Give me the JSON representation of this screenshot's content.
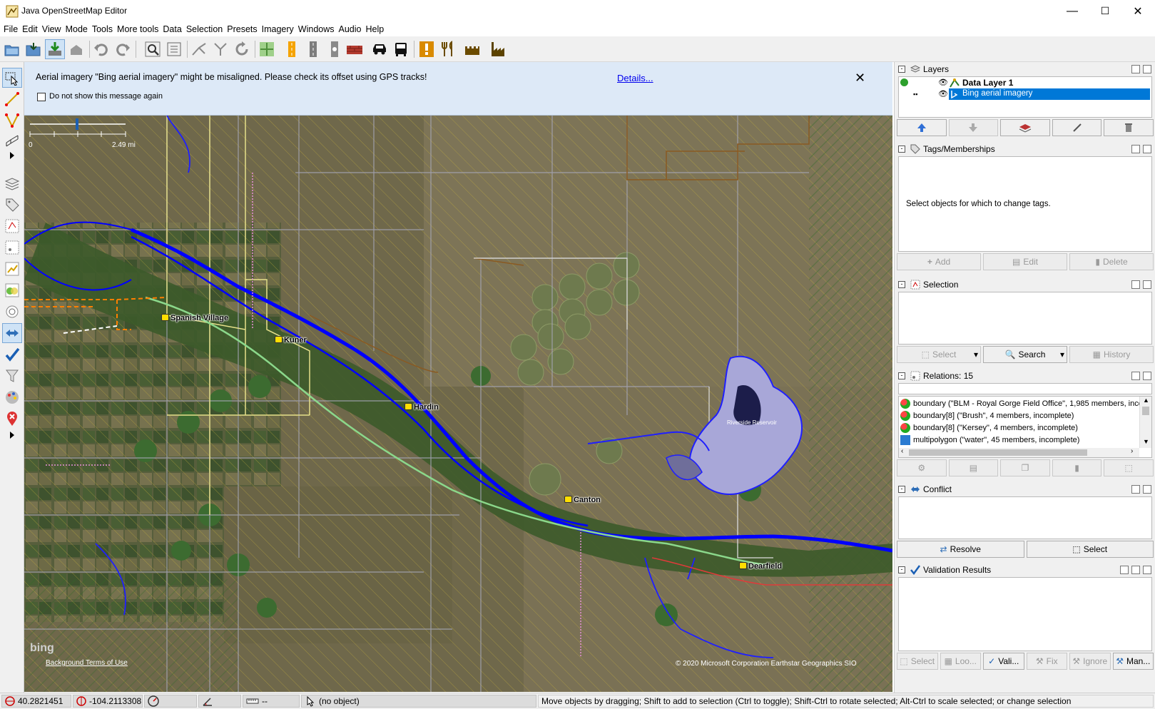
{
  "window": {
    "title": "Java OpenStreetMap Editor",
    "minimize": "—",
    "maximize": "☐",
    "close": "✕"
  },
  "menu": [
    "File",
    "Edit",
    "View",
    "Mode",
    "Tools",
    "More tools",
    "Data",
    "Selection",
    "Presets",
    "Imagery",
    "Windows",
    "Audio",
    "Help"
  ],
  "notice": {
    "message": "Aerial imagery \"Bing aerial imagery\" might be misaligned. Please check its offset using GPS tracks!",
    "details_link": "Details...",
    "checkbox_label": "Do not show this message again",
    "close": "✕"
  },
  "map": {
    "scale_start": "0",
    "scale_end": "2.49 mi",
    "places": [
      "Spanish Village",
      "Kuner",
      "Hardin",
      "Canton",
      "Dearfield"
    ],
    "reservoir": "Riverside Reservoir",
    "bing_logo": "bing",
    "terms": "Background Terms of Use",
    "attribution": "© 2020 Microsoft Corporation Earthstar Geographics SIO"
  },
  "layers": {
    "title": "Layers",
    "items": [
      {
        "name": "Data Layer 1",
        "bold": true,
        "selected": false
      },
      {
        "name": "Bing aerial imagery",
        "bold": false,
        "selected": true
      }
    ]
  },
  "tags": {
    "title": "Tags/Memberships",
    "empty_text": "Select objects for which to change tags.",
    "buttons": [
      "Add",
      "Edit",
      "Delete"
    ]
  },
  "selection": {
    "title": "Selection",
    "buttons": [
      "Select",
      "Search",
      "History"
    ]
  },
  "relations": {
    "title": "Relations: 15",
    "items": [
      "boundary (\"BLM - Royal Gorge Field Office\", 1,985 members, incom",
      "boundary[8] (\"Brush\", 4 members, incomplete)",
      "boundary[8] (\"Kersey\", 4 members, incomplete)",
      "multipolygon (\"water\", 45 members, incomplete)"
    ]
  },
  "conflict": {
    "title": "Conflict",
    "buttons": [
      "Resolve",
      "Select"
    ]
  },
  "validation": {
    "title": "Validation Results",
    "buttons": [
      "Select",
      "Loo...",
      "Vali...",
      "Fix",
      "Ignore",
      "Man..."
    ]
  },
  "status": {
    "lat": "40.2821451",
    "lon": "-104.2113308",
    "heading": "",
    "angle": "",
    "distance": "--",
    "object": "(no object)",
    "help": "Move objects by dragging; Shift to add to selection (Ctrl to toggle); Shift-Ctrl to rotate selected; Alt-Ctrl to scale selected; or change selection"
  },
  "colors": {
    "selected_row": "#0078d7",
    "water": "#0000ff",
    "notice_bg": "#dde9f7",
    "boundary": "#ff7f00"
  }
}
